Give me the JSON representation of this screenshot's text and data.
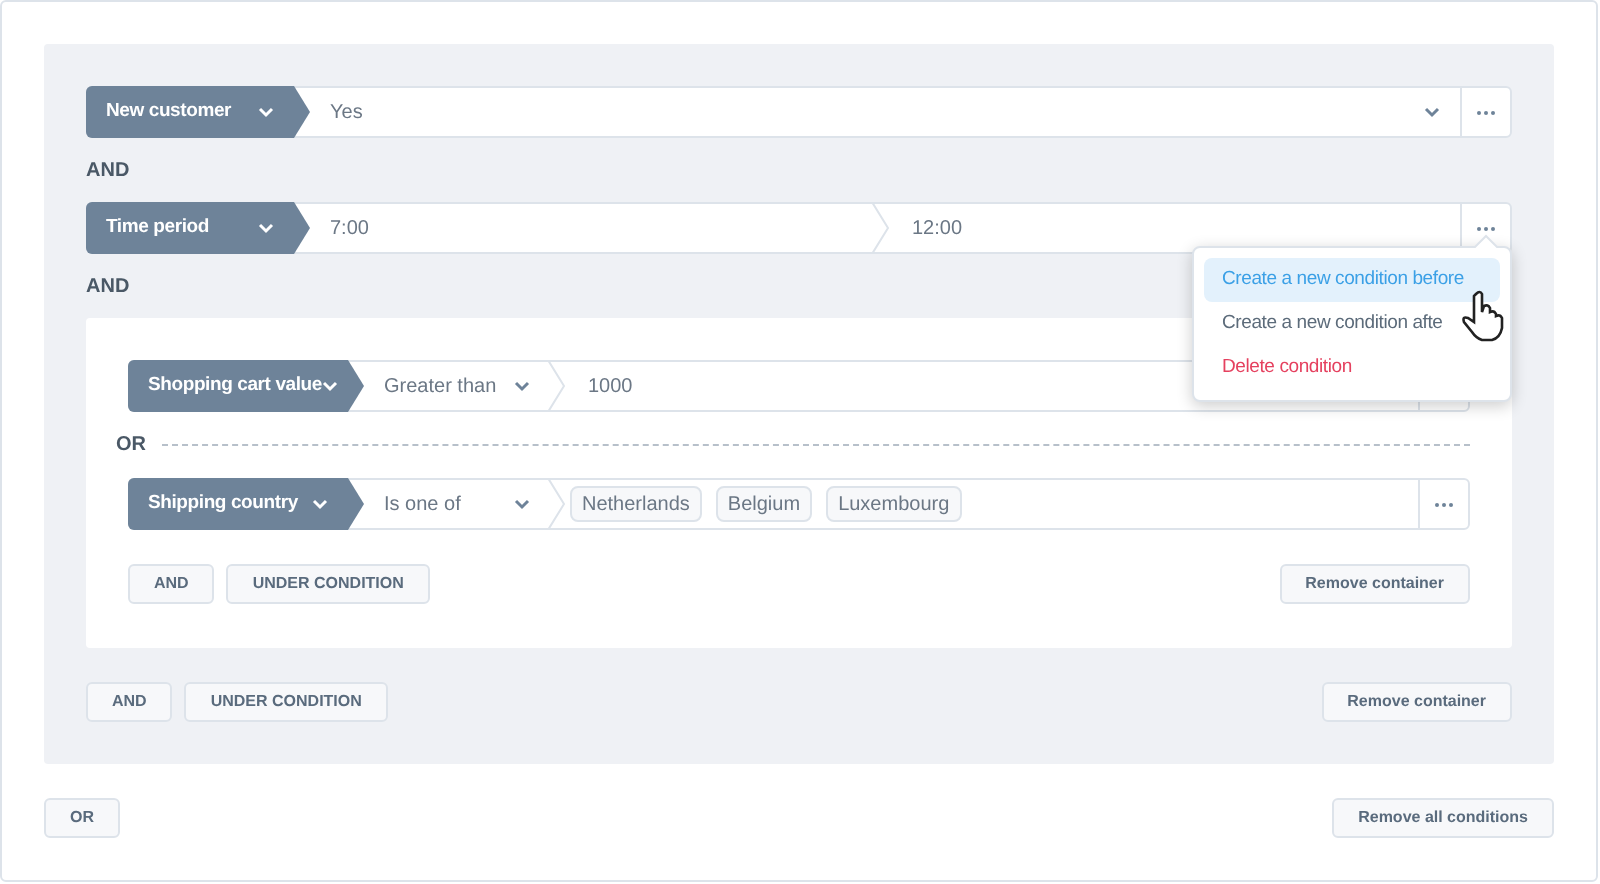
{
  "groups": [
    {
      "kind": "condition",
      "field": "New customer",
      "menu_open": false,
      "parts": [
        {
          "kind": "select",
          "value": "Yes"
        }
      ]
    },
    {
      "kind": "joiner",
      "label": "AND"
    },
    {
      "kind": "condition",
      "field": "Time period",
      "menu_open": true,
      "parts": [
        {
          "kind": "text",
          "value": "7:00"
        },
        {
          "kind": "text",
          "value": "12:00"
        }
      ]
    },
    {
      "kind": "joiner",
      "label": "AND"
    },
    {
      "kind": "container",
      "items": [
        {
          "kind": "condition",
          "field": "Shopping cart value",
          "menu_open": false,
          "parts": [
            {
              "kind": "select",
              "value": "Greater than"
            },
            {
              "kind": "text",
              "value": "1000"
            }
          ]
        },
        {
          "kind": "divider",
          "label": "OR"
        },
        {
          "kind": "condition",
          "field": "Shipping country",
          "menu_open": false,
          "parts": [
            {
              "kind": "select",
              "value": "Is one of"
            },
            {
              "kind": "tags",
              "values": [
                "Netherlands",
                "Belgium",
                "Luxembourg"
              ]
            }
          ]
        }
      ],
      "buttons": [
        "AND",
        "UNDER CONDITION"
      ],
      "remove": "Remove container"
    }
  ],
  "panel_buttons": [
    "AND",
    "UNDER CONDITION"
  ],
  "panel_remove": "Remove container",
  "menu": {
    "items": [
      {
        "kind": "normal",
        "label": "Create a new condition before",
        "selected": true
      },
      {
        "kind": "normal",
        "label": "Create a new condition afte",
        "selected": false
      },
      {
        "kind": "danger",
        "label": "Delete condition",
        "selected": false
      }
    ]
  },
  "footer": {
    "button": "OR",
    "remove": "Remove all conditions"
  }
}
